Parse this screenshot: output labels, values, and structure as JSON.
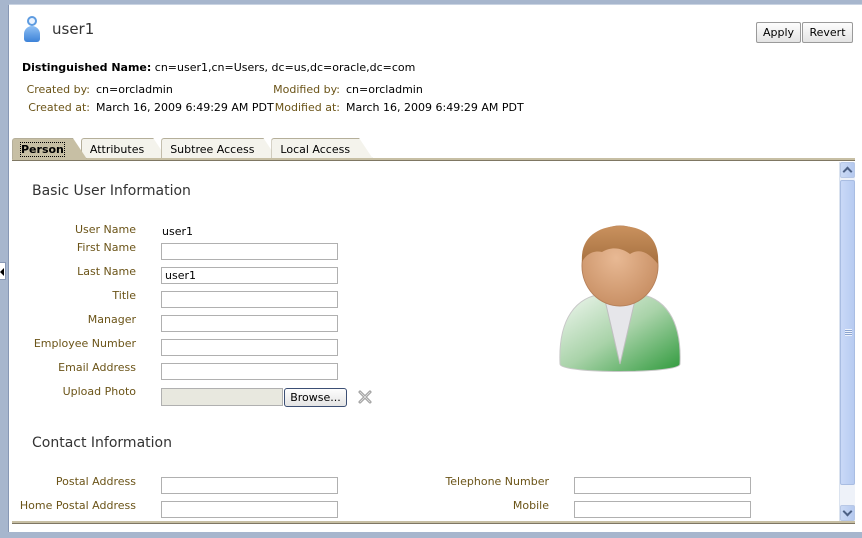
{
  "header": {
    "title": "user1",
    "icon": "user-icon",
    "apply_label": "Apply",
    "revert_label": "Revert"
  },
  "entry": {
    "dn_label": "Distinguished Name:",
    "dn_value": "cn=user1,cn=Users, dc=us,dc=oracle,dc=com",
    "created_by_label": "Created by:",
    "created_by_value": "cn=orcladmin",
    "created_at_label": "Created at:",
    "created_at_value": "March 16, 2009 6:49:29 AM PDT",
    "modified_by_label": "Modified by:",
    "modified_by_value": "cn=orcladmin",
    "modified_at_label": "Modified at:",
    "modified_at_value": "March 16, 2009 6:49:29 AM PDT"
  },
  "tabs": [
    {
      "label": "Person",
      "active": true
    },
    {
      "label": "Attributes",
      "active": false
    },
    {
      "label": "Subtree Access",
      "active": false
    },
    {
      "label": "Local Access",
      "active": false
    }
  ],
  "basic": {
    "title": "Basic User Information",
    "user_name_label": "User Name",
    "user_name_value": "user1",
    "first_name_label": "First Name",
    "first_name_value": "",
    "last_name_label": "Last Name",
    "last_name_value": "user1",
    "title_label": "Title",
    "title_value": "",
    "manager_label": "Manager",
    "manager_value": "",
    "employee_number_label": "Employee Number",
    "employee_number_value": "",
    "email_label": "Email Address",
    "email_value": "",
    "upload_photo_label": "Upload Photo",
    "browse_label": "Browse...",
    "photo": "person-avatar-icon"
  },
  "contact": {
    "title": "Contact Information",
    "postal_label": "Postal Address",
    "postal_value": "",
    "home_postal_label": "Home Postal Address",
    "home_postal_value": "",
    "telephone_label": "Telephone Number",
    "telephone_value": "",
    "mobile_label": "Mobile",
    "mobile_value": ""
  }
}
